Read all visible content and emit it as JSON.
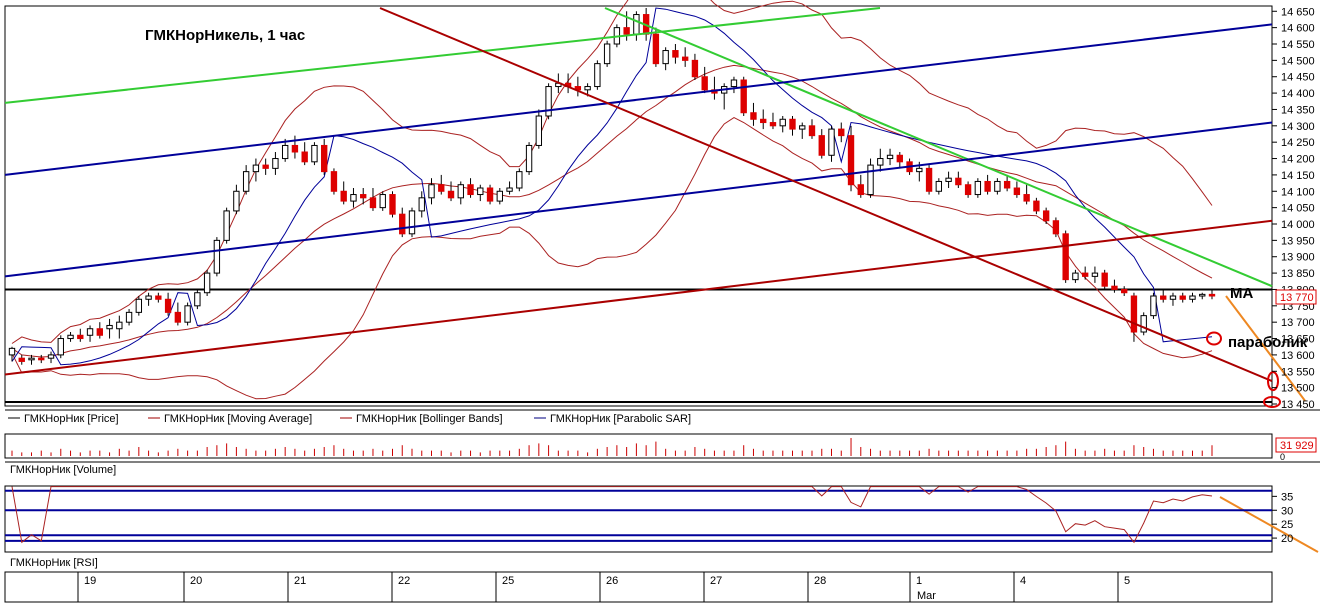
{
  "title": "ГМКНорНикель,  1 час",
  "annotations": {
    "ma": "МА",
    "parabolic": "параболик"
  },
  "legend": [
    {
      "label": "ГМКНорНик [Price]",
      "color": "#000000"
    },
    {
      "label": "ГМКНорНик [Moving Average]",
      "color": "#a00000"
    },
    {
      "label": "ГМКНорНик [Bollinger Bands]",
      "color": "#a00000"
    },
    {
      "label": "ГМКНорНик [Parabolic SAR]",
      "color": "#000080"
    }
  ],
  "volume_panel": {
    "label": "ГМКНорНик [Volume]",
    "last_value": "31 929",
    "axis_zero": "0"
  },
  "rsi_panel": {
    "label": "ГМКНорНик [RSI]"
  },
  "colors": {
    "candle_up": "#ffffff",
    "candle_down": "#dd0000",
    "green_line": "#33cc33",
    "blue_line": "#000099",
    "red_channel": "#aa0000",
    "orange_forecast": "#ee8822",
    "highlight": "#dd0000"
  },
  "chart_data": {
    "type": "candlestick",
    "title": "ГМКНорНикель,  1 час",
    "y_ticks": [
      "14 650",
      "14 600",
      "14 550",
      "14 500",
      "14 450",
      "14 400",
      "14 350",
      "14 300",
      "14 250",
      "14 200",
      "14 150",
      "14 100",
      "14 050",
      "14 000",
      "13 950",
      "13 900",
      "13 850",
      "13 800",
      "13 750",
      "13 700",
      "13 650",
      "13 600",
      "13 550",
      "13 500",
      "13 450"
    ],
    "ylim": [
      13450,
      14660
    ],
    "last_price": "13 770",
    "x_ticks": [
      "19",
      "20",
      "21",
      "22",
      "25",
      "26",
      "27",
      "28",
      "1",
      "4",
      "5"
    ],
    "x_month_label": "Mar",
    "rsi_ticks": [
      "35",
      "30",
      "25",
      "20"
    ],
    "ohlc": [
      [
        13600,
        13625,
        13580,
        13620
      ],
      [
        13590,
        13600,
        13570,
        13580
      ],
      [
        13585,
        13600,
        13570,
        13590
      ],
      [
        13590,
        13600,
        13575,
        13585
      ],
      [
        13590,
        13610,
        13575,
        13600
      ],
      [
        13600,
        13660,
        13590,
        13650
      ],
      [
        13650,
        13670,
        13640,
        13660
      ],
      [
        13660,
        13680,
        13640,
        13650
      ],
      [
        13660,
        13690,
        13640,
        13680
      ],
      [
        13680,
        13700,
        13650,
        13660
      ],
      [
        13680,
        13710,
        13650,
        13690
      ],
      [
        13680,
        13720,
        13650,
        13700
      ],
      [
        13700,
        13740,
        13690,
        13730
      ],
      [
        13730,
        13780,
        13720,
        13770
      ],
      [
        13770,
        13790,
        13750,
        13780
      ],
      [
        13780,
        13790,
        13760,
        13770
      ],
      [
        13770,
        13790,
        13720,
        13730
      ],
      [
        13730,
        13760,
        13690,
        13700
      ],
      [
        13700,
        13760,
        13690,
        13750
      ],
      [
        13750,
        13800,
        13740,
        13790
      ],
      [
        13790,
        13860,
        13780,
        13850
      ],
      [
        13850,
        13960,
        13840,
        13950
      ],
      [
        13950,
        14050,
        13940,
        14040
      ],
      [
        14040,
        14120,
        14030,
        14100
      ],
      [
        14100,
        14180,
        14090,
        14160
      ],
      [
        14160,
        14200,
        14130,
        14180
      ],
      [
        14180,
        14200,
        14150,
        14170
      ],
      [
        14170,
        14220,
        14150,
        14200
      ],
      [
        14200,
        14260,
        14190,
        14240
      ],
      [
        14240,
        14270,
        14200,
        14220
      ],
      [
        14220,
        14250,
        14180,
        14190
      ],
      [
        14190,
        14250,
        14180,
        14240
      ],
      [
        14240,
        14260,
        14150,
        14160
      ],
      [
        14160,
        14170,
        14090,
        14100
      ],
      [
        14100,
        14130,
        14060,
        14070
      ],
      [
        14070,
        14110,
        14050,
        14090
      ],
      [
        14090,
        14110,
        14060,
        14080
      ],
      [
        14080,
        14110,
        14040,
        14050
      ],
      [
        14050,
        14100,
        14040,
        14090
      ],
      [
        14090,
        14100,
        14020,
        14030
      ],
      [
        14030,
        14050,
        13960,
        13970
      ],
      [
        13970,
        14050,
        13960,
        14040
      ],
      [
        14040,
        14100,
        14020,
        14080
      ],
      [
        14080,
        14140,
        14060,
        14120
      ],
      [
        14120,
        14150,
        14090,
        14100
      ],
      [
        14100,
        14130,
        14070,
        14080
      ],
      [
        14080,
        14130,
        14060,
        14120
      ],
      [
        14120,
        14140,
        14080,
        14090
      ],
      [
        14090,
        14120,
        14070,
        14110
      ],
      [
        14110,
        14120,
        14060,
        14070
      ],
      [
        14070,
        14110,
        14060,
        14100
      ],
      [
        14100,
        14130,
        14090,
        14110
      ],
      [
        14110,
        14170,
        14100,
        14160
      ],
      [
        14160,
        14250,
        14150,
        14240
      ],
      [
        14240,
        14350,
        14230,
        14330
      ],
      [
        14330,
        14430,
        14320,
        14420
      ],
      [
        14420,
        14460,
        14400,
        14430
      ],
      [
        14430,
        14460,
        14400,
        14420
      ],
      [
        14420,
        14450,
        14390,
        14410
      ],
      [
        14410,
        14430,
        14390,
        14420
      ],
      [
        14420,
        14500,
        14410,
        14490
      ],
      [
        14490,
        14560,
        14480,
        14550
      ],
      [
        14550,
        14610,
        14540,
        14600
      ],
      [
        14600,
        14650,
        14560,
        14580
      ],
      [
        14580,
        14650,
        14560,
        14640
      ],
      [
        14640,
        14660,
        14560,
        14580
      ],
      [
        14580,
        14600,
        14480,
        14490
      ],
      [
        14490,
        14540,
        14470,
        14530
      ],
      [
        14530,
        14550,
        14490,
        14510
      ],
      [
        14510,
        14540,
        14480,
        14500
      ],
      [
        14500,
        14520,
        14440,
        14450
      ],
      [
        14450,
        14480,
        14400,
        14410
      ],
      [
        14410,
        14450,
        14380,
        14400
      ],
      [
        14400,
        14430,
        14350,
        14420
      ],
      [
        14420,
        14450,
        14400,
        14440
      ],
      [
        14440,
        14450,
        14330,
        14340
      ],
      [
        14340,
        14370,
        14300,
        14320
      ],
      [
        14320,
        14350,
        14290,
        14310
      ],
      [
        14310,
        14340,
        14290,
        14300
      ],
      [
        14300,
        14330,
        14280,
        14320
      ],
      [
        14320,
        14330,
        14270,
        14290
      ],
      [
        14290,
        14310,
        14260,
        14300
      ],
      [
        14300,
        14320,
        14260,
        14270
      ],
      [
        14270,
        14290,
        14200,
        14210
      ],
      [
        14210,
        14300,
        14190,
        14290
      ],
      [
        14290,
        14310,
        14250,
        14270
      ],
      [
        14270,
        14300,
        14100,
        14120
      ],
      [
        14120,
        14150,
        14080,
        14090
      ],
      [
        14090,
        14200,
        14080,
        14180
      ],
      [
        14180,
        14230,
        14160,
        14200
      ],
      [
        14200,
        14230,
        14180,
        14210
      ],
      [
        14210,
        14220,
        14170,
        14190
      ],
      [
        14190,
        14200,
        14150,
        14160
      ],
      [
        14160,
        14190,
        14130,
        14170
      ],
      [
        14170,
        14180,
        14090,
        14100
      ],
      [
        14100,
        14140,
        14090,
        14130
      ],
      [
        14130,
        14160,
        14110,
        14140
      ],
      [
        14140,
        14160,
        14110,
        14120
      ],
      [
        14120,
        14130,
        14080,
        14090
      ],
      [
        14090,
        14140,
        14080,
        14130
      ],
      [
        14130,
        14150,
        14090,
        14100
      ],
      [
        14100,
        14140,
        14090,
        14130
      ],
      [
        14130,
        14150,
        14100,
        14110
      ],
      [
        14110,
        14130,
        14080,
        14090
      ],
      [
        14090,
        14120,
        14060,
        14070
      ],
      [
        14070,
        14080,
        14030,
        14040
      ],
      [
        14040,
        14050,
        14000,
        14010
      ],
      [
        14010,
        14020,
        13960,
        13970
      ],
      [
        13970,
        13980,
        13820,
        13830
      ],
      [
        13830,
        13860,
        13820,
        13850
      ],
      [
        13850,
        13870,
        13830,
        13840
      ],
      [
        13840,
        13870,
        13820,
        13850
      ],
      [
        13850,
        13860,
        13800,
        13810
      ],
      [
        13810,
        13830,
        13790,
        13800
      ],
      [
        13800,
        13810,
        13780,
        13790
      ],
      [
        13780,
        13790,
        13640,
        13670
      ],
      [
        13670,
        13730,
        13660,
        13720
      ],
      [
        13720,
        13790,
        13710,
        13780
      ],
      [
        13780,
        13800,
        13760,
        13770
      ],
      [
        13770,
        13790,
        13750,
        13780
      ],
      [
        13780,
        13790,
        13760,
        13770
      ],
      [
        13770,
        13790,
        13760,
        13780
      ],
      [
        13780,
        13790,
        13770,
        13785
      ],
      [
        13785,
        13800,
        13770,
        13780
      ]
    ],
    "volumes": [
      3,
      2,
      2,
      3,
      2,
      4,
      3,
      2,
      3,
      3,
      2,
      4,
      3,
      5,
      3,
      2,
      3,
      4,
      3,
      3,
      5,
      6,
      7,
      5,
      4,
      3,
      3,
      4,
      5,
      4,
      3,
      4,
      5,
      6,
      4,
      3,
      3,
      4,
      3,
      4,
      6,
      4,
      3,
      3,
      3,
      2,
      3,
      3,
      2,
      3,
      3,
      3,
      4,
      6,
      7,
      6,
      3,
      3,
      3,
      2,
      4,
      5,
      6,
      5,
      7,
      6,
      8,
      4,
      3,
      3,
      5,
      4,
      3,
      3,
      3,
      6,
      4,
      3,
      3,
      3,
      3,
      3,
      3,
      4,
      4,
      3,
      10,
      5,
      4,
      3,
      3,
      3,
      3,
      3,
      4,
      3,
      3,
      3,
      3,
      3,
      3,
      3,
      3,
      3,
      4,
      4,
      5,
      6,
      8,
      4,
      3,
      3,
      4,
      3,
      3,
      6,
      5,
      4,
      3,
      3,
      3,
      3,
      3,
      6
    ]
  }
}
